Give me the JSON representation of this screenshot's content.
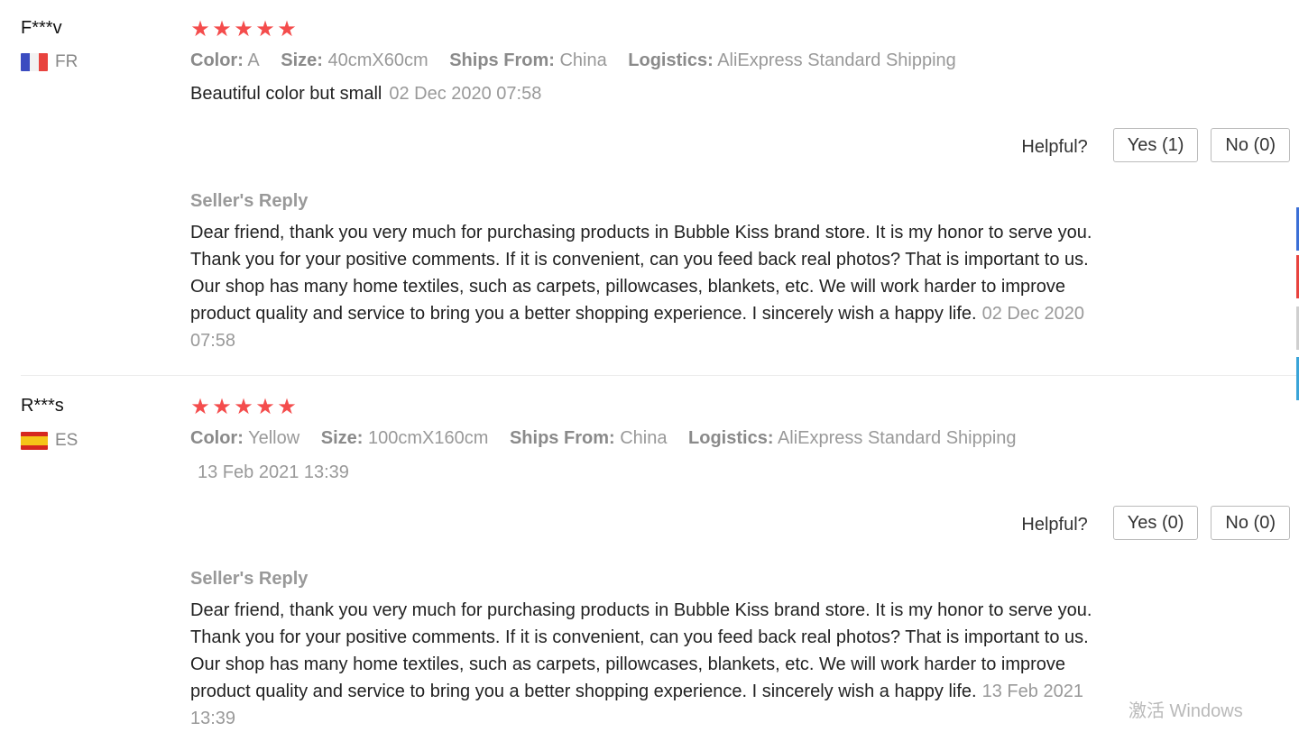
{
  "reviews": [
    {
      "user": "F***v",
      "country": "FR",
      "rating_stars": 5,
      "specs": [
        {
          "label": "Color:",
          "value": "A"
        },
        {
          "label": "Size:",
          "value": "40cmX60cm"
        },
        {
          "label": "Ships From:",
          "value": "China"
        },
        {
          "label": "Logistics:",
          "value": "AliExpress Standard Shipping"
        }
      ],
      "comment": "Beautiful color but small",
      "date": "02 Dec 2020 07:58",
      "helpful_label": "Helpful?",
      "yes_label": "Yes (1)",
      "no_label": "No (0)",
      "reply_title": "Seller's Reply",
      "reply_text": "Dear friend, thank you very much for purchasing products in Bubble Kiss brand store. It is my honor to serve you. Thank you for your positive comments. If it is convenient, can you feed back real photos? That is important to us. Our shop has many home textiles, such as carpets, pillowcases, blankets, etc. We will work harder to improve product quality and service to bring you a better shopping experience. I sincerely wish a happy life.",
      "reply_date": "02 Dec 2020 07:58"
    },
    {
      "user": "R***s",
      "country": "ES",
      "rating_stars": 5,
      "specs": [
        {
          "label": "Color:",
          "value": "Yellow"
        },
        {
          "label": "Size:",
          "value": "100cmX160cm"
        },
        {
          "label": "Ships From:",
          "value": "China"
        },
        {
          "label": "Logistics:",
          "value": "AliExpress Standard Shipping"
        }
      ],
      "comment": "",
      "date": "13 Feb 2021 13:39",
      "helpful_label": "Helpful?",
      "yes_label": "Yes (0)",
      "no_label": "No (0)",
      "reply_title": "Seller's Reply",
      "reply_text": "Dear friend, thank you very much for purchasing products in Bubble Kiss brand store. It is my honor to serve you. Thank you for your positive comments. If it is convenient, can you feed back real photos? That is important to us. Our shop has many home textiles, such as carpets, pillowcases, blankets, etc. We will work harder to improve product quality and service to bring you a better shopping experience. I sincerely wish a happy life.",
      "reply_date": "13 Feb 2021 13:39"
    }
  ],
  "colors": {
    "star": "#f44c4c",
    "muted": "#999999"
  },
  "watermark": "激活 Windows"
}
